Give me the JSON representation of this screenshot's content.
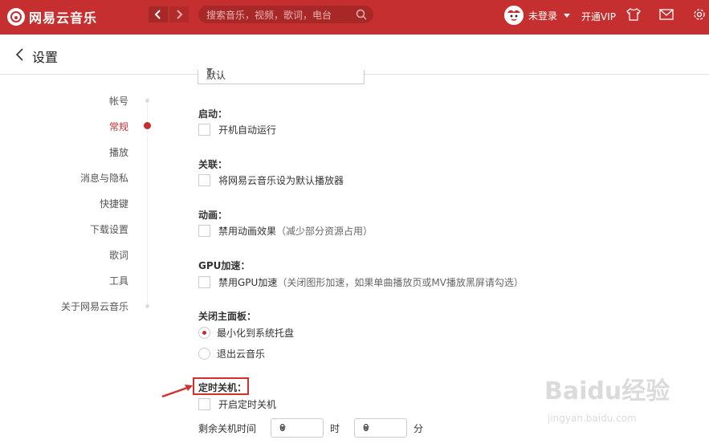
{
  "app": {
    "name": "网易云音乐",
    "accent_color": "#c62f2f"
  },
  "topbar": {
    "search_placeholder": "搜索音乐，视频，歌词，电台",
    "user_name": "未登录",
    "vip_label": "开通VIP",
    "icons": [
      "skin-icon",
      "mail-icon",
      "gear-icon"
    ]
  },
  "header": {
    "title": "设置"
  },
  "sidebar": {
    "items": [
      {
        "label": "帐号",
        "active": false
      },
      {
        "label": "常规",
        "active": true
      },
      {
        "label": "播放",
        "active": false
      },
      {
        "label": "消息与隐私",
        "active": false
      },
      {
        "label": "快捷键",
        "active": false
      },
      {
        "label": "下载设置",
        "active": false
      },
      {
        "label": "歌词",
        "active": false
      },
      {
        "label": "工具",
        "active": false
      },
      {
        "label": "关于网易云音乐",
        "active": false
      }
    ]
  },
  "settings": {
    "top_select_value": "默认",
    "startup": {
      "title": "启动：",
      "option": "开机自动运行",
      "checked": false
    },
    "association": {
      "title": "关联：",
      "option": "将网易云音乐设为默认播放器",
      "checked": false
    },
    "animation": {
      "title": "动画：",
      "option": "禁用动画效果",
      "note": "（减少部分资源占用）",
      "checked": false
    },
    "gpu": {
      "title": "GPU加速：",
      "option": "禁用GPU加速",
      "note": "（关闭图形加速，如果单曲播放页或MV播放黑屏请勾选）",
      "checked": false
    },
    "close_panel": {
      "title": "关闭主面板：",
      "options": [
        {
          "label": "最小化到系统托盘",
          "checked": true
        },
        {
          "label": "退出云音乐",
          "checked": false
        }
      ]
    },
    "timer_shutdown": {
      "title": "定时关机：",
      "option": "开启定时关机",
      "checked": false,
      "remaining_label": "剩余关机时间",
      "hours_value": "0",
      "hours_unit": "时",
      "minutes_value": "0",
      "minutes_unit": "分"
    }
  },
  "watermark": {
    "brand": "Baidu经验",
    "url": "jingyan.baidu.com"
  }
}
